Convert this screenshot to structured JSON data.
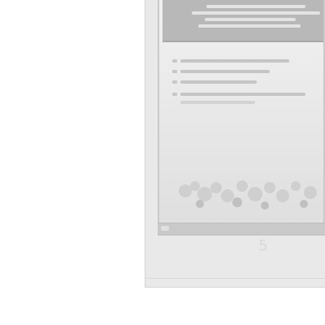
{
  "slide": {
    "page_number": "5"
  },
  "colors": {
    "page_bg": "#ffffff",
    "frame_bg": "#e9e9e9",
    "slide_header": "#b8b8b8",
    "page_number": "#d9d9d9"
  },
  "icons": {
    "slide_footer_icon": "slide-footer-icon",
    "bullet_icon": "bullet-icon",
    "decor_icon": "floral-decoration-icon"
  }
}
